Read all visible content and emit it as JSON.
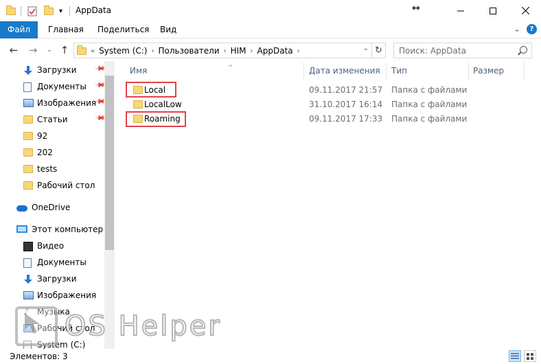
{
  "window": {
    "title": "AppData",
    "controls": [
      "minimize",
      "maximize",
      "close"
    ]
  },
  "ribbon": {
    "tabs": [
      "Файл",
      "Главная",
      "Поделиться",
      "Вид"
    ]
  },
  "address": {
    "overflow": "«",
    "crumbs": [
      "System (C:)",
      "Пользователи",
      "HIM",
      "AppData"
    ]
  },
  "search": {
    "placeholder": "Поиск: AppData"
  },
  "nav": {
    "quick_access": [
      {
        "label": "Загрузки",
        "icon": "download-icon",
        "pinned": true
      },
      {
        "label": "Документы",
        "icon": "documents-icon",
        "pinned": true
      },
      {
        "label": "Изображения",
        "icon": "pictures-icon",
        "pinned": true
      },
      {
        "label": "Статьи",
        "icon": "folder-icon",
        "pinned": true
      },
      {
        "label": "92",
        "icon": "folder-icon",
        "pinned": false
      },
      {
        "label": "202",
        "icon": "folder-icon",
        "pinned": false
      },
      {
        "label": "tests",
        "icon": "folder-icon",
        "pinned": false
      },
      {
        "label": "Рабочий стол",
        "icon": "folder-icon",
        "pinned": false
      }
    ],
    "onedrive": "OneDrive",
    "this_pc": "Этот компьютер",
    "pc_items": [
      {
        "label": "Видео",
        "icon": "video-icon"
      },
      {
        "label": "Документы",
        "icon": "documents-icon"
      },
      {
        "label": "Загрузки",
        "icon": "download-icon"
      },
      {
        "label": "Изображения",
        "icon": "pictures-icon"
      },
      {
        "label": "Музыка",
        "icon": "music-icon"
      },
      {
        "label": "Рабочий стол",
        "icon": "desktop-icon"
      },
      {
        "label": "System (C:)",
        "icon": "drive-icon"
      }
    ]
  },
  "columns": {
    "name": "Имя",
    "date": "Дата изменения",
    "type": "Тип",
    "size": "Размер"
  },
  "files": [
    {
      "name": "Local",
      "date": "09.11.2017 21:57",
      "type": "Папка с файлами",
      "highlighted": true
    },
    {
      "name": "LocalLow",
      "date": "31.10.2017 16:14",
      "type": "Папка с файлами",
      "highlighted": false
    },
    {
      "name": "Roaming",
      "date": "09.11.2017 17:33",
      "type": "Папка с файлами",
      "highlighted": true
    }
  ],
  "status": {
    "count": "Элементов: 3"
  },
  "watermark": {
    "text": "OS Helper"
  },
  "colors": {
    "accent": "#1979ca",
    "highlight_box": "#e0434b",
    "folder": "#f8d775"
  }
}
